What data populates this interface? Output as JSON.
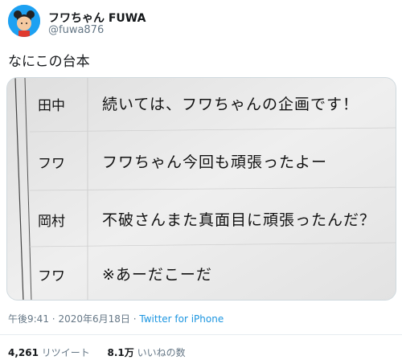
{
  "author": {
    "name": "フワちゃん FUWA",
    "handle": "@fuwa876"
  },
  "tweet": {
    "text": "なにこの台本"
  },
  "script_lines": [
    {
      "speaker": "田中",
      "line": "続いては、フワちゃんの企画です！"
    },
    {
      "speaker": "フワ",
      "line": "フワちゃん今回も頑張ったよー"
    },
    {
      "speaker": "岡村",
      "line": "不破さんまた真面目に頑張ったんだ？"
    },
    {
      "speaker": "フワ",
      "line": "※あーだこーだ"
    }
  ],
  "meta": {
    "time": "午後9:41",
    "separator": "·",
    "date": "2020年6月18日",
    "source": "Twitter for iPhone"
  },
  "stats": {
    "retweets_count": "4,261",
    "retweets_label": "リツイート",
    "likes_count": "8.1万",
    "likes_label": "いいねの数"
  }
}
